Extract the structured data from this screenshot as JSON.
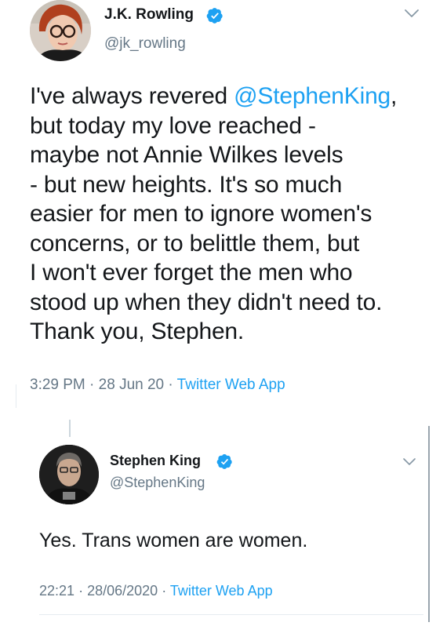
{
  "tweets": [
    {
      "display_name": "J.K. Rowling",
      "handle": "@jk_rowling",
      "text_before_mention": "I've always revered ",
      "mention": "@StephenKing",
      "text_lines": [
        ",",
        "but today my love reached -",
        "maybe not Annie Wilkes levels",
        "- but new heights. It's so much",
        "easier for men to ignore women's",
        "concerns, or to belittle them, but",
        "I won't ever forget the men who",
        "stood up when they didn't need to.",
        "Thank you, Stephen."
      ],
      "time": "3:29 PM",
      "separator": "·",
      "date": "28 Jun 20",
      "source": "Twitter Web App",
      "verified_icon": "verified-badge-icon",
      "menu_icon": "chevron-down-icon"
    },
    {
      "display_name": "Stephen King",
      "handle": "@StephenKing",
      "text": "Yes. Trans women are women.",
      "time": "22:21",
      "separator": "·",
      "date": "28/06/2020",
      "source": "Twitter Web App",
      "verified_icon": "verified-badge-icon",
      "menu_icon": "chevron-down-icon"
    }
  ],
  "colors": {
    "link": "#1da1f2",
    "secondary_text": "#657786",
    "primary_text": "#14171a",
    "verified": "#1da1f2"
  }
}
